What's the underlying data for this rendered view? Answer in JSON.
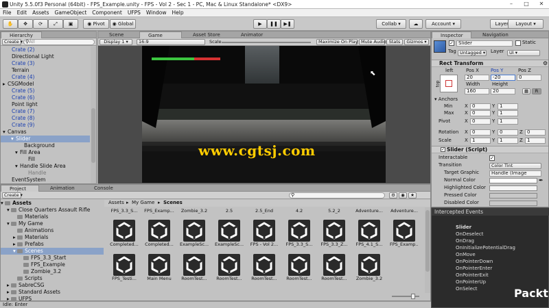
{
  "window": {
    "title": "Unity 5.5.0f3 Personal (64bit) - FPS_Example.unity - FPS - Vol 2 - Sec 1 - PC, Mac & Linux Standalone* <DX9>"
  },
  "menu": [
    "File",
    "Edit",
    "Assets",
    "GameObject",
    "Component",
    "UFPS",
    "Window",
    "Help"
  ],
  "toolbar": {
    "pivot": "Pivot",
    "global": "Global",
    "collab": "Collab",
    "account": "Account",
    "layers": "Layers",
    "layout": "Layout"
  },
  "hierarchy": {
    "tab": "Hierarchy",
    "create": "Create",
    "search_placeholder": "All",
    "items": [
      {
        "label": "Crate (2)",
        "indent": 2,
        "prefab": true
      },
      {
        "label": "Directional Light",
        "indent": 2,
        "prefab": false
      },
      {
        "label": "Crate (3)",
        "indent": 2,
        "prefab": true
      },
      {
        "label": "Terrain",
        "indent": 2,
        "prefab": false
      },
      {
        "label": "Crate (4)",
        "indent": 2,
        "prefab": true
      },
      {
        "label": "CSGModel",
        "indent": 1,
        "prefab": false,
        "arrow": "▸"
      },
      {
        "label": "Crate (5)",
        "indent": 2,
        "prefab": true
      },
      {
        "label": "Crate (6)",
        "indent": 2,
        "prefab": true
      },
      {
        "label": "Point light",
        "indent": 2,
        "prefab": false
      },
      {
        "label": "Crate (7)",
        "indent": 2,
        "prefab": true
      },
      {
        "label": "Crate (8)",
        "indent": 2,
        "prefab": true
      },
      {
        "label": "Crate (9)",
        "indent": 2,
        "prefab": true
      },
      {
        "label": "Canvas",
        "indent": 1,
        "prefab": false,
        "arrow": "▾"
      },
      {
        "label": "Slider",
        "indent": 3,
        "prefab": false,
        "arrow": "▾",
        "selected": true
      },
      {
        "label": "Background",
        "indent": 5,
        "prefab": false
      },
      {
        "label": "Fill Area",
        "indent": 4,
        "prefab": false,
        "arrow": "▾"
      },
      {
        "label": "Fill",
        "indent": 6,
        "prefab": false
      },
      {
        "label": "Handle Slide Area",
        "indent": 4,
        "prefab": false,
        "arrow": "▾"
      },
      {
        "label": "Handle",
        "indent": 6,
        "prefab": false,
        "dim": true
      },
      {
        "label": "EventSystem",
        "indent": 2,
        "prefab": false
      }
    ]
  },
  "scene_tabs": {
    "scene": "Scene",
    "game": "Game",
    "asset_store": "Asset Store",
    "animator": "Animator"
  },
  "game_bar": {
    "display": "Display 1",
    "aspect": "16:9",
    "scale_label": "Scale",
    "maximize": "Maximize On Play",
    "mute": "Mute Audio",
    "stats": "Stats",
    "gizmos": "Gizmos"
  },
  "game_view": {
    "health_fraction": 0.62,
    "watermark": "www.cgtsj.com"
  },
  "project": {
    "tab": "Project",
    "animation_tab": "Animation",
    "console_tab": "Console",
    "create": "Create",
    "tree": [
      {
        "label": "Assets",
        "indent": 0,
        "bold": true,
        "arrow": "▾"
      },
      {
        "label": "Close Quarters Assault Rifle",
        "indent": 1,
        "arrow": "▾"
      },
      {
        "label": "Materials",
        "indent": 2
      },
      {
        "label": "My Game",
        "indent": 1,
        "arrow": "▾"
      },
      {
        "label": "Animations",
        "indent": 2
      },
      {
        "label": "Materials",
        "indent": 2,
        "arrow": "▸"
      },
      {
        "label": "Prefabs",
        "indent": 2,
        "arrow": "▸"
      },
      {
        "label": "Scenes",
        "indent": 2,
        "arrow": "▾",
        "selected": true
      },
      {
        "label": "FPS_3.3_Start",
        "indent": 3
      },
      {
        "label": "FPS_Example",
        "indent": 3
      },
      {
        "label": "Zombie_3.2",
        "indent": 3
      },
      {
        "label": "Scripts",
        "indent": 2
      },
      {
        "label": "SabreCSG",
        "indent": 1,
        "arrow": "▸"
      },
      {
        "label": "Standard Assets",
        "indent": 1,
        "arrow": "▸"
      },
      {
        "label": "UFPS",
        "indent": 1,
        "arrow": "▸"
      }
    ],
    "breadcrumb": [
      "Assets",
      "My Game",
      "Scenes"
    ],
    "top_labels": [
      "FPS_3.3_S...",
      "FPS_Examp...",
      "Zombie_3.2",
      "2.5",
      "2.5_End",
      "4.2",
      "5.2_2",
      "Adventure...",
      "Adventure..."
    ],
    "row1_labels": [
      "Completed...",
      "Completed...",
      "ExampleSc...",
      "ExampleSc...",
      "FPS - Vol 2...",
      "FPS_3.3_S...",
      "FPS_3.3_Z...",
      "FPS_4.1_S...",
      "FPS_Examp..."
    ],
    "row2_labels": [
      "FPS_Testi...",
      "Main Menu",
      "RoomTest...",
      "RoomTest...",
      "RoomTest...",
      "RoomTest...",
      "RoomTest...",
      "Zombie_3.2",
      ""
    ]
  },
  "inspector": {
    "tab": "Inspector",
    "nav_tab": "Navigation",
    "object_name": "Slider",
    "static_label": "Static",
    "tag_label": "Tag",
    "tag_value": "Untagged",
    "layer_label": "Layer",
    "layer_value": "UI",
    "rect_transform": "Rect Transform",
    "anchor_preset": "left",
    "side_label": "top",
    "pos_x_label": "Pos X",
    "pos_y_label": "Pos Y",
    "pos_z_label": "Pos Z",
    "pos_x": "20",
    "pos_y": "-20",
    "pos_z": "0",
    "width_label": "Width",
    "height_label": "Height",
    "width": "160",
    "height": "20",
    "blueprint": "R",
    "anchors": "Anchors",
    "min_label": "Min",
    "max_label": "Max",
    "min_x": "0",
    "min_y": "1",
    "max_x": "0",
    "max_y": "1",
    "pivot_label": "Pivot",
    "pivot_x": "0",
    "pivot_y": "1",
    "rotation_label": "Rotation",
    "rot_x": "0",
    "rot_y": "0",
    "rot_z": "0",
    "scale_label": "Scale",
    "scale_x": "1",
    "scale_y": "1",
    "scale_z": "1",
    "slider_script": "Slider (Script)",
    "interactable_label": "Interactable",
    "transition_label": "Transition",
    "transition_value": "Color Tint",
    "target_graphic_label": "Target Graphic",
    "target_graphic_value": "Handle (Image",
    "normal_color": "Normal Color",
    "highlighted_color": "Highlighted Color",
    "pressed_color": "Pressed Color",
    "disabled_color": "Disabled Color"
  },
  "events": {
    "header": "Intercepted Events",
    "object": "Slider",
    "items": [
      "OnDeselect",
      "OnDrag",
      "OnInitializePotentialDrag",
      "OnMove",
      "OnPointerDown",
      "OnPointerEnter",
      "OnPointerExit",
      "OnPointerUp",
      "OnSelect"
    ]
  },
  "brand": "Packt>",
  "status": {
    "text": "Idle: Enter"
  },
  "axis_labels": {
    "x": "X",
    "y": "Y",
    "z": "Z"
  },
  "colors": {
    "selection": "#8aa2c8",
    "panel": "#c2c2c2",
    "health_green": "#3cc640",
    "health_red": "#d63232",
    "watermark": "#ffcc00",
    "events_bg": "#2b2b2b",
    "brand": "#ffffff"
  }
}
